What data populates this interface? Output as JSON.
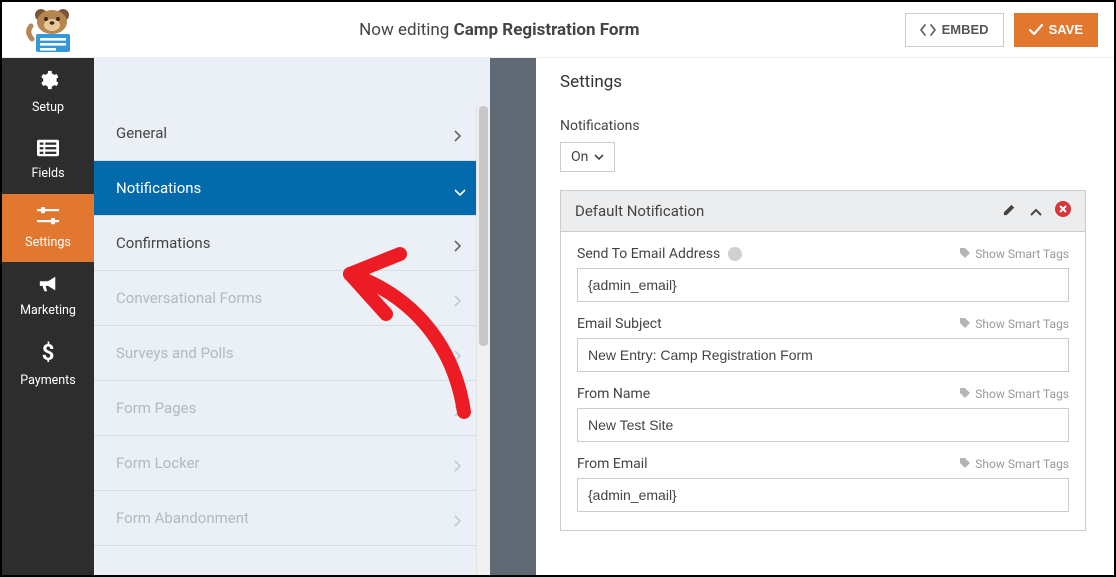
{
  "topbar": {
    "editing_prefix": "Now editing ",
    "editing_name": "Camp Registration Form",
    "embed_label": "EMBED",
    "save_label": "SAVE"
  },
  "sidebar": {
    "setup": "Setup",
    "fields": "Fields",
    "settings": "Settings",
    "marketing": "Marketing",
    "payments": "Payments"
  },
  "settings_panel": {
    "general": "General",
    "notifications": "Notifications",
    "confirmations": "Confirmations",
    "conversational": "Conversational Forms",
    "surveys": "Surveys and Polls",
    "form_pages": "Form Pages",
    "form_locker": "Form Locker",
    "form_abandonment": "Form Abandonment"
  },
  "content": {
    "heading": "Settings",
    "notifications_label": "Notifications",
    "toggle_value": "On",
    "card_title": "Default Notification",
    "smart_tags_label": "Show Smart Tags",
    "fields": {
      "send_to": {
        "label": "Send To Email Address",
        "value": "{admin_email}"
      },
      "subject": {
        "label": "Email Subject",
        "value": "New Entry: Camp Registration Form"
      },
      "from_name": {
        "label": "From Name",
        "value": "New Test Site"
      },
      "from_email": {
        "label": "From Email",
        "value": "{admin_email}"
      }
    }
  }
}
